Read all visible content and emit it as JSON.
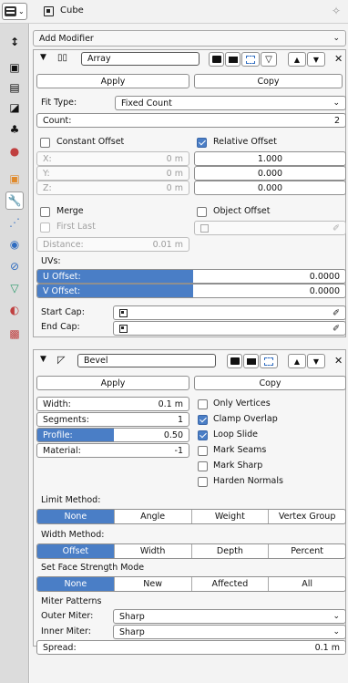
{
  "header": {
    "object_name": "Cube"
  },
  "add_modifier_label": "Add Modifier",
  "array": {
    "name": "Array",
    "apply_label": "Apply",
    "copy_label": "Copy",
    "fit_type_label": "Fit Type:",
    "fit_type_value": "Fixed Count",
    "count_label": "Count:",
    "count_value": "2",
    "constant_offset_label": "Constant Offset",
    "relative_offset_label": "Relative Offset",
    "x_label": "X:",
    "x_value": "0 m",
    "y_label": "Y:",
    "y_value": "0 m",
    "z_label": "Z:",
    "z_value": "0 m",
    "rel_x": "1.000",
    "rel_y": "0.000",
    "rel_z": "0.000",
    "merge_label": "Merge",
    "first_last_label": "First Last",
    "distance_label": "Distance:",
    "distance_value": "0.01 m",
    "object_offset_label": "Object Offset",
    "uvs_label": "UVs:",
    "u_offset_label": "U Offset:",
    "u_offset_value": "0.0000",
    "v_offset_label": "V Offset:",
    "v_offset_value": "0.0000",
    "start_cap_label": "Start Cap:",
    "end_cap_label": "End Cap:"
  },
  "bevel": {
    "name": "Bevel",
    "apply_label": "Apply",
    "copy_label": "Copy",
    "width_label": "Width:",
    "width_value": "0.1 m",
    "segments_label": "Segments:",
    "segments_value": "1",
    "profile_label": "Profile:",
    "profile_value": "0.50",
    "material_label": "Material:",
    "material_value": "-1",
    "only_vertices_label": "Only Vertices",
    "clamp_overlap_label": "Clamp Overlap",
    "loop_slide_label": "Loop Slide",
    "mark_seams_label": "Mark Seams",
    "mark_sharp_label": "Mark Sharp",
    "harden_normals_label": "Harden Normals",
    "limit_method_label": "Limit Method:",
    "limit_options": [
      "None",
      "Angle",
      "Weight",
      "Vertex Group"
    ],
    "width_method_label": "Width Method:",
    "width_options": [
      "Offset",
      "Width",
      "Depth",
      "Percent"
    ],
    "face_strength_label": "Set Face Strength Mode",
    "face_strength_options": [
      "None",
      "New",
      "Affected",
      "All"
    ],
    "miter_patterns_label": "Miter Patterns",
    "outer_miter_label": "Outer Miter:",
    "outer_miter_value": "Sharp",
    "inner_miter_label": "Inner Miter:",
    "inner_miter_value": "Sharp",
    "spread_label": "Spread:",
    "spread_value": "0.1 m"
  },
  "colors": {
    "accent": "#4a7ec6"
  }
}
